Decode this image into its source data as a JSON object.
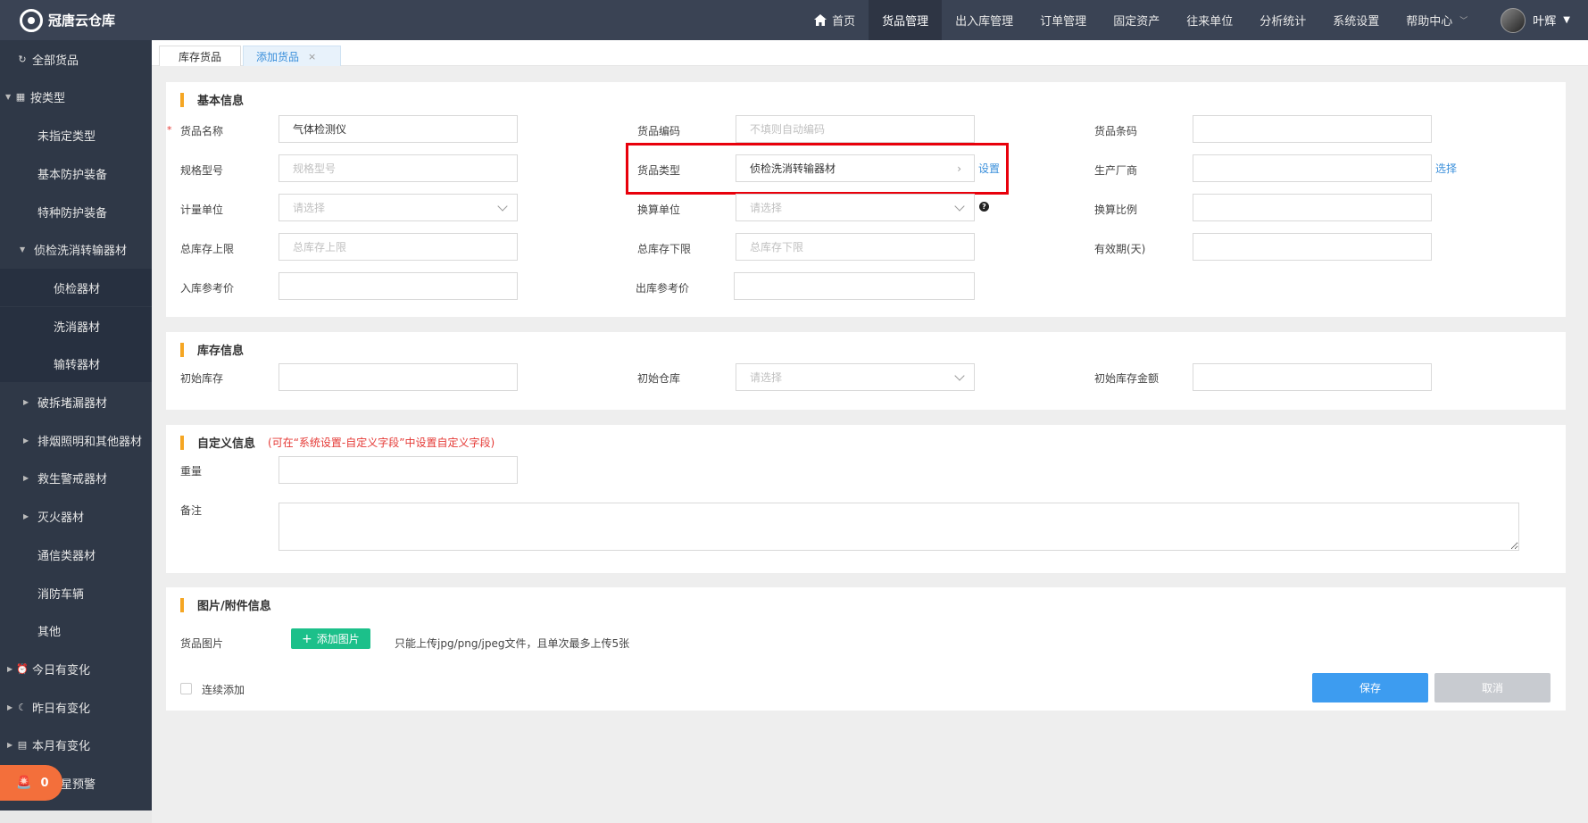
{
  "app": {
    "name": "冠唐云仓库"
  },
  "nav": {
    "home": "首页",
    "items": [
      "货品管理",
      "出入库管理",
      "订单管理",
      "固定资产",
      "往来单位",
      "分析统计",
      "系统设置",
      "帮助中心"
    ],
    "user": "叶辉"
  },
  "sidebar": {
    "all": "全部货品",
    "by_type": "按类型",
    "items": [
      "未指定类型",
      "基本防护装备",
      "特种防护装备",
      "侦检洗消转输器材",
      "侦检器材",
      "洗消器材",
      "输转器材",
      "破拆堵漏器材",
      "排烟照明和其他器材",
      "救生警戒器材",
      "灭火器材",
      "通信类器材",
      "消防车辆",
      "其他"
    ],
    "today": "今日有变化",
    "yesterday": "昨日有变化",
    "month": "本月有变化",
    "alarm_count": "0",
    "alarm_label": "星预警"
  },
  "tabs": [
    {
      "label": "库存货品"
    },
    {
      "label": "添加货品",
      "close": "×"
    }
  ],
  "basic": {
    "title": "基本信息",
    "name_label": "货品名称",
    "name_value": "气体检测仪",
    "code_label": "货品编码",
    "code_ph": "不填则自动编码",
    "barcode_label": "货品条码",
    "spec_label": "规格型号",
    "spec_ph": "规格型号",
    "type_label": "货品类型",
    "type_value": "侦检洗消转输器材",
    "type_set": "设置",
    "maker_label": "生产厂商",
    "maker_select": "选择",
    "unit_label": "计量单位",
    "unit_ph": "请选择",
    "conv_unit_label": "换算单位",
    "conv_unit_ph": "请选择",
    "ratio_label": "换算比例",
    "max_label": "总库存上限",
    "max_ph": "总库存上限",
    "min_label": "总库存下限",
    "min_ph": "总库存下限",
    "expire_label": "有效期(天)",
    "in_price_label": "入库参考价",
    "out_price_label": "出库参考价"
  },
  "stock": {
    "title": "库存信息",
    "init_label": "初始库存",
    "wh_label": "初始仓库",
    "wh_ph": "请选择",
    "amount_label": "初始库存金额"
  },
  "custom": {
    "title": "自定义信息",
    "note": "(可在“系统设置-自定义字段”中设置自定义字段)",
    "weight_label": "重量",
    "remark_label": "备注"
  },
  "attach": {
    "title": "图片/附件信息",
    "img_label": "货品图片",
    "add_btn": "添加图片",
    "hint": "只能上传jpg/png/jpeg文件，且单次最多上传5张",
    "continue": "连续添加",
    "save": "保存",
    "cancel": "取消"
  }
}
